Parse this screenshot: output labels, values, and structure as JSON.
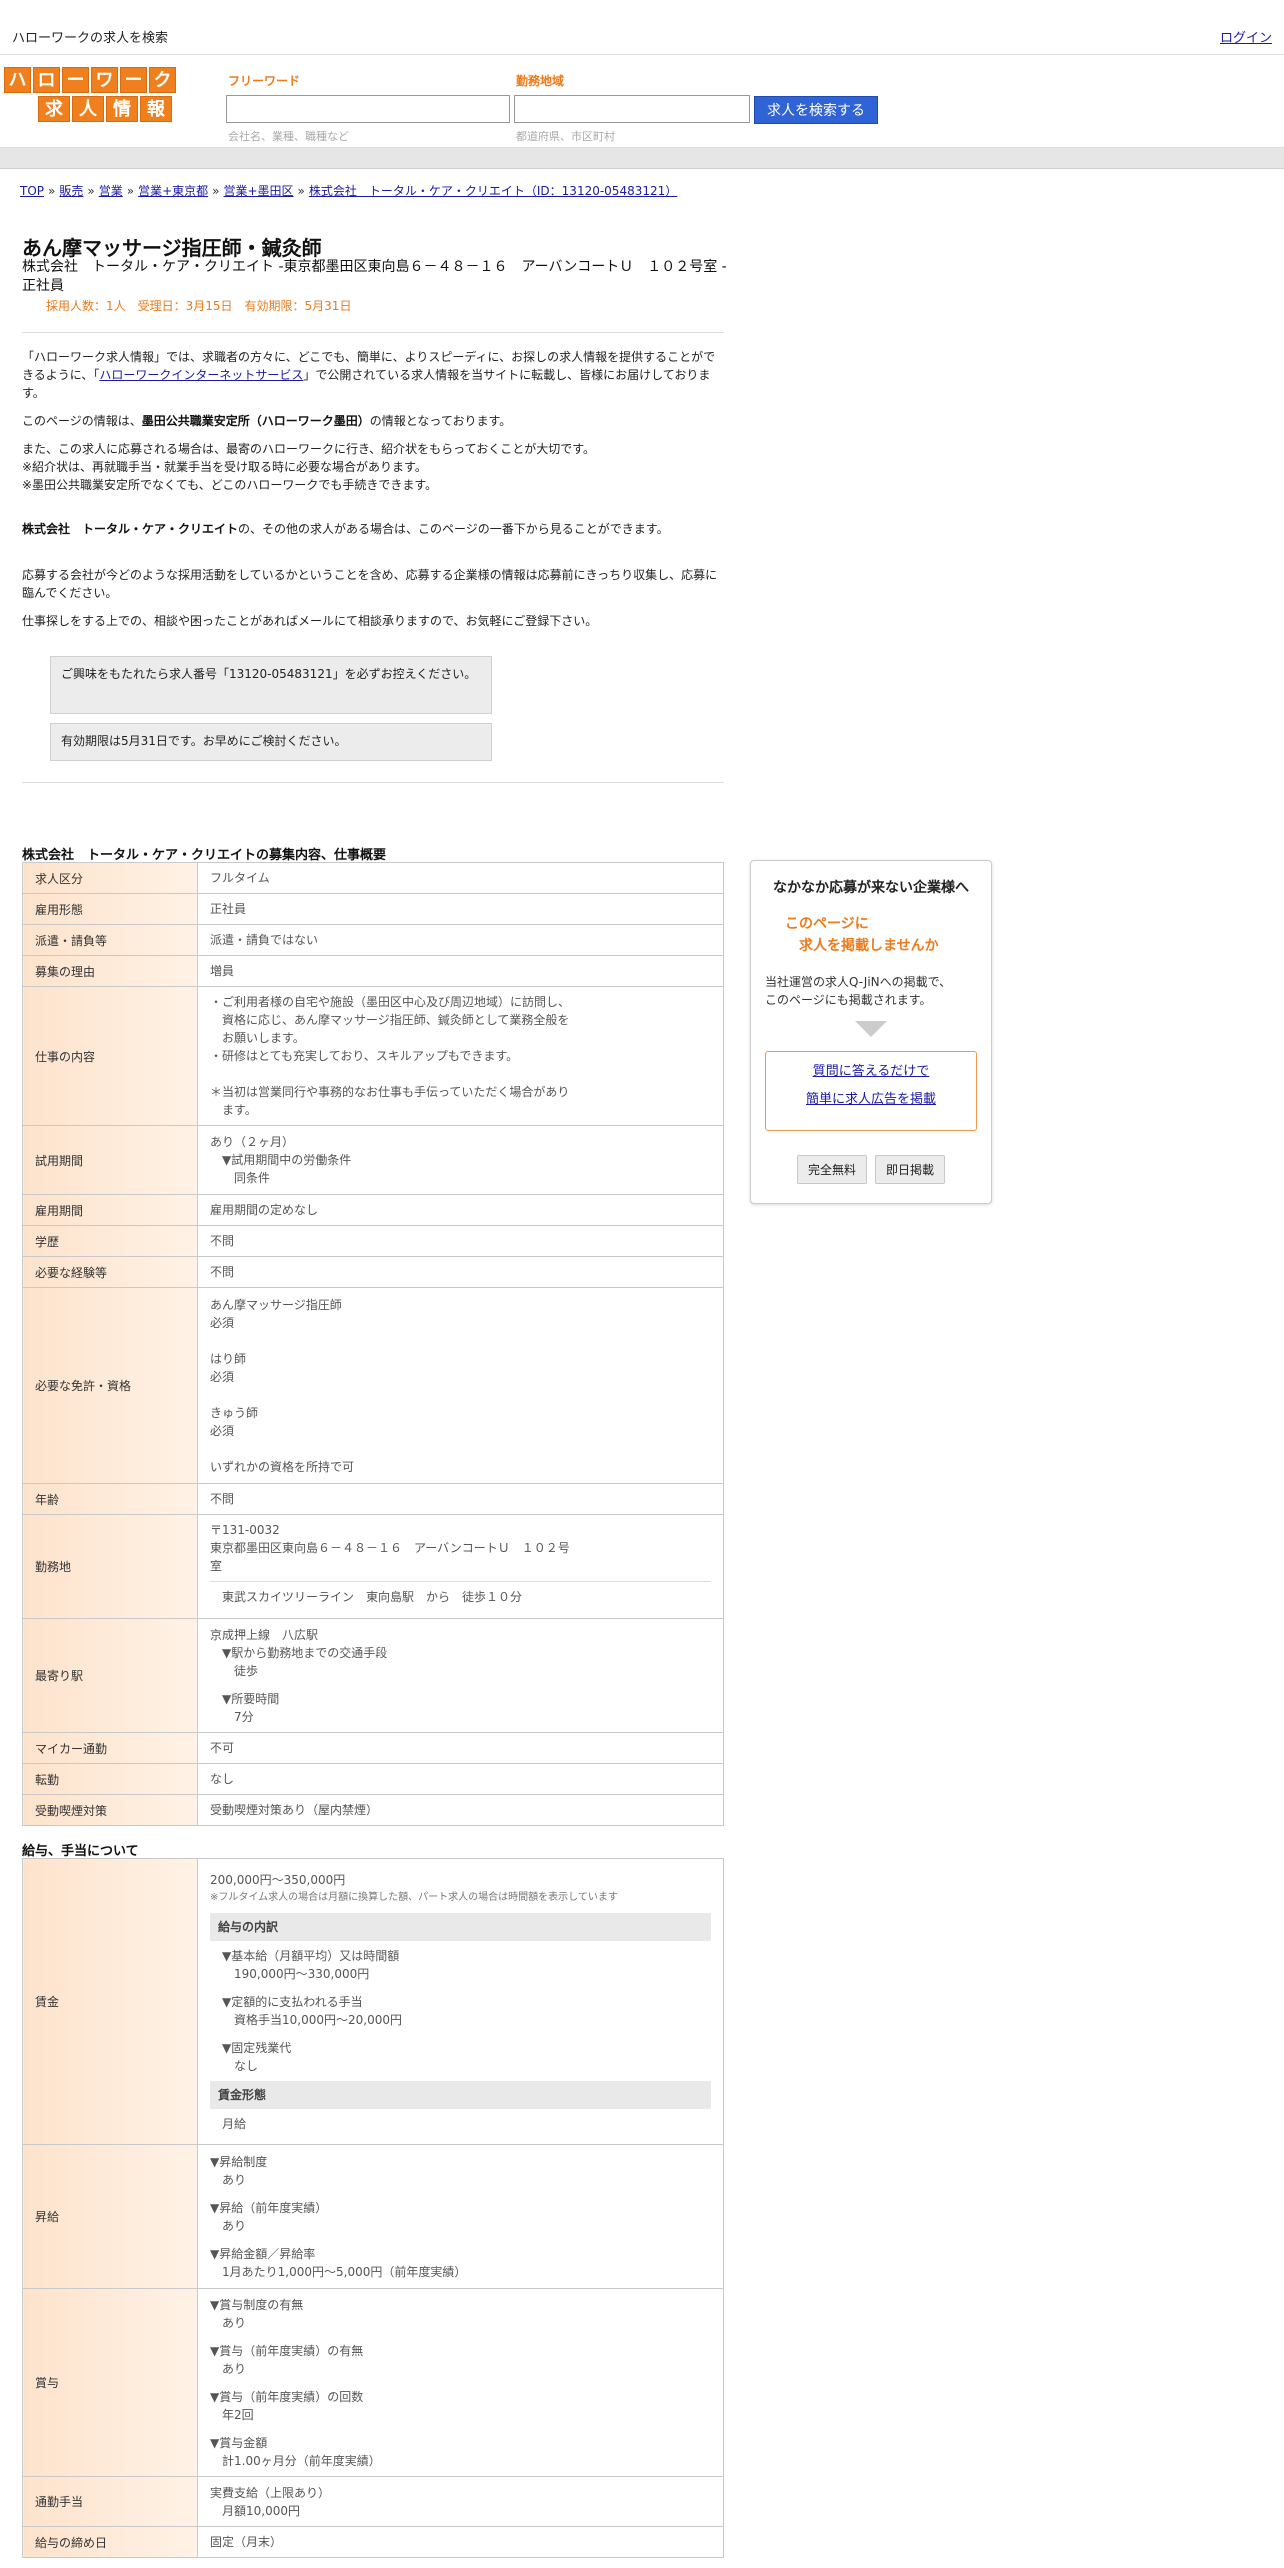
{
  "topbar": {
    "title": "ハローワークの求人を検索",
    "login": "ログイン"
  },
  "logo": {
    "row1": [
      "ハ",
      "ロ",
      "ー",
      "ワ",
      "ー",
      "ク"
    ],
    "row2": [
      "求",
      "人",
      "情",
      "報"
    ]
  },
  "search": {
    "freeword_label": "フリーワード",
    "freeword_hint": "会社名、業種、職種など",
    "area_label": "勤務地域",
    "area_hint": "都道府県、市区町村",
    "button": "求人を検索する"
  },
  "breadcrumb": [
    "TOP",
    "販売",
    "営業",
    "営業+東京都",
    "営業+墨田区",
    "株式会社　トータル・ケア・クリエイト（ID：13120-05483121）"
  ],
  "breadcrumb_sep": "»",
  "job": {
    "title": "あん摩マッサージ指圧師・鍼灸師",
    "subtitle": "株式会社　トータル・ケア・クリエイト -東京都墨田区東向島６－４８－１６　アーバンコートＵ　１０２号室 - 正社員",
    "meta": "採用人数：1人　受理日：3月15日　有効期限：5月31日"
  },
  "intro": {
    "p1_a": "「ハローワーク求人情報」では、求職者の方々に、どこでも、簡単に、よりスピーディに、お探しの求人情報を提供することができるように、「",
    "p1_link": "ハローワークインターネットサービス",
    "p1_b": "」で公開されている求人情報を当サイトに転載し、皆様にお届けしております。",
    "p2_a": "このページの情報は、",
    "p2_bold": "墨田公共職業安定所（ハローワーク墨田）",
    "p2_b": "の情報となっております。",
    "p3_l1": "また、この求人に応募される場合は、最寄のハローワークに行き、紹介状をもらっておくことが大切です。",
    "p3_l2": "※紹介状は、再就職手当・就業手当を受け取る時に必要な場合があります。",
    "p3_l3": "※墨田公共職業安定所でなくても、どこのハローワークでも手続きできます。",
    "p4_bold": "株式会社　トータル・ケア・クリエイト",
    "p4_b": "の、その他の求人がある場合は、このページの一番下から見ることができます。",
    "p5": "応募する会社が今どのような採用活動をしているかということを含め、応募する企業様の情報は応募前にきっちり収集し、応募に臨んでください。",
    "p6": "仕事探しをする上での、相談や困ったことがあればメールにて相談承りますので、お気軽にご登録下さい。",
    "notice1": "ご興味をもたれたら求人番号「13120-05483121」を必ずお控えください。",
    "notice2": "有効期限は5月31日です。お早めにご検討ください。"
  },
  "section1": {
    "heading": "株式会社　トータル・ケア・クリエイトの募集内容、仕事概要",
    "rows": {
      "kubun": {
        "k": "求人区分",
        "v": "フルタイム"
      },
      "keitai": {
        "k": "雇用形態",
        "v": "正社員"
      },
      "haken": {
        "k": "派遣・請負等",
        "v": "派遣・請負ではない"
      },
      "riyu": {
        "k": "募集の理由",
        "v": "増員"
      },
      "naiyo": {
        "k": "仕事の内容",
        "l1": "・ご利用者様の自宅や施設（墨田区中心及び周辺地域）に訪問し、",
        "l2": "資格に応じ、あん摩マッサージ指圧師、鍼灸師として業務全般を",
        "l3": "お願いします。",
        "l4": "・研修はとても充実しており、スキルアップもできます。",
        "l5": "＊当初は営業同行や事務的なお仕事も手伝っていただく場合があり",
        "l6": "ます。"
      },
      "shiyo": {
        "k": "試用期間",
        "l1": "あり（２ヶ月）",
        "l2": "▼試用期間中の労働条件",
        "l3": "同条件"
      },
      "koyo": {
        "k": "雇用期間",
        "v": "雇用期間の定めなし"
      },
      "gakureki": {
        "k": "学歴",
        "v": "不問"
      },
      "keiken": {
        "k": "必要な経験等",
        "v": "不問"
      },
      "menkyo": {
        "k": "必要な免許・資格",
        "l1": "あん摩マッサージ指圧師",
        "l2": "必須",
        "l3": "はり師",
        "l4": "必須",
        "l5": "きゅう師",
        "l6": "必須",
        "l7": "いずれかの資格を所持で可"
      },
      "nenrei": {
        "k": "年齢",
        "v": "不問"
      },
      "kinmuchi": {
        "k": "勤務地",
        "l1": "〒131-0032",
        "l2": "東京都墨田区東向島６－４８－１６　アーバンコートＵ　１０２号",
        "l3": "室",
        "l4": "東武スカイツリーライン　東向島駅　から　徒歩１０分"
      },
      "eki": {
        "k": "最寄り駅",
        "l1": "京成押上線　八広駅",
        "l2": "▼駅から勤務地までの交通手段",
        "l3": "徒歩",
        "l4": "▼所要時間",
        "l5": "7分"
      },
      "mycar": {
        "k": "マイカー通勤",
        "v": "不可"
      },
      "tenkin": {
        "k": "転勤",
        "v": "なし"
      },
      "kitsuen": {
        "k": "受動喫煙対策",
        "v": "受動喫煙対策あり（屋内禁煙）"
      }
    }
  },
  "section2": {
    "heading": "給与、手当について",
    "chingin": {
      "k": "賃金",
      "range": "200,000円〜350,000円",
      "note": "※フルタイム求人の場合は月額に換算した額、パート求人の場合は時間額を表示しています",
      "breakdown_head": "給与の内訳",
      "b1": "▼基本給（月額平均）又は時間額",
      "b1v": "190,000円〜330,000円",
      "b2": "▼定額的に支払われる手当",
      "b2v": "資格手当10,000円〜20,000円",
      "b3": "▼固定残業代",
      "b3v": "なし",
      "form_head": "賃金形態",
      "form_v": "月給"
    },
    "shokyu": {
      "k": "昇給",
      "a1": "▼昇給制度",
      "a1v": "あり",
      "a2": "▼昇給（前年度実績）",
      "a2v": "あり",
      "a3": "▼昇給金額／昇給率",
      "a3v": "1月あたり1,000円〜5,000円（前年度実績）"
    },
    "shoyo": {
      "k": "賞与",
      "a1": "▼賞与制度の有無",
      "a1v": "あり",
      "a2": "▼賞与（前年度実績）の有無",
      "a2v": "あり",
      "a3": "▼賞与（前年度実績）の回数",
      "a3v": "年2回",
      "a4": "▼賞与金額",
      "a4v": "計1.00ヶ月分（前年度実績）"
    },
    "tsukin": {
      "k": "通勤手当",
      "l1": "実費支給（上限あり）",
      "l2": "月額10,000円"
    },
    "shimebi": {
      "k": "給与の締め日",
      "v": "固定（月末）"
    }
  },
  "sidebar": {
    "heading": "なかなか応募が来ない企業様へ",
    "orange1": "このページに",
    "orange2": "求人を掲載しませんか",
    "desc1": "当社運営の求人Q-JiNへの掲載で、",
    "desc2": "このページにも掲載されます。",
    "link1": "質問に答えるだけで",
    "link2": "簡単に求人広告を掲載",
    "btn1": "完全無料",
    "btn2": "即日掲載"
  }
}
